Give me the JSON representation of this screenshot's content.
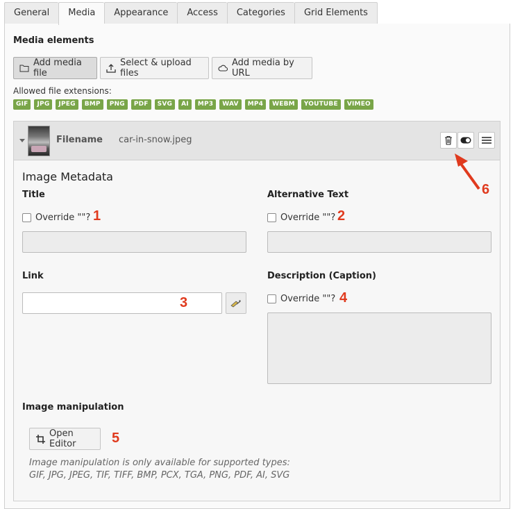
{
  "tabs": [
    {
      "label": "General",
      "active": false
    },
    {
      "label": "Media",
      "active": true
    },
    {
      "label": "Appearance",
      "active": false
    },
    {
      "label": "Access",
      "active": false
    },
    {
      "label": "Categories",
      "active": false
    },
    {
      "label": "Grid Elements",
      "active": false
    }
  ],
  "media": {
    "section_title": "Media elements",
    "buttons": {
      "add_file": "Add media file",
      "select_upload": "Select & upload files",
      "add_url": "Add media by URL"
    },
    "allowed_label": "Allowed file extensions:",
    "extensions": [
      "GIF",
      "JPG",
      "JPEG",
      "BMP",
      "PNG",
      "PDF",
      "SVG",
      "AI",
      "MP3",
      "WAV",
      "MP4",
      "WEBM",
      "YOUTUBE",
      "VIMEO"
    ],
    "extension_color": "#79a548"
  },
  "file": {
    "filename_label": "Filename",
    "filename_value": "car-in-snow.jpeg",
    "metadata_title": "Image Metadata",
    "title_label": "Title",
    "title_override": "Override \"\"?",
    "alt_label": "Alternative Text",
    "alt_override": "Override \"\"?",
    "link_label": "Link",
    "description_label": "Description (Caption)",
    "description_override": "Override \"\"?",
    "manipulation_title": "Image manipulation",
    "open_editor": "Open Editor",
    "manipulation_note_1": "Image manipulation is only available for supported types:",
    "manipulation_note_2": "GIF, JPG, JPEG, TIF, TIFF, BMP, PCX, TGA, PNG, PDF, AI, SVG"
  },
  "annotations": {
    "n1": "1",
    "n2": "2",
    "n3": "3",
    "n4": "4",
    "n5": "5",
    "n6": "6",
    "color": "#e03a1e"
  }
}
